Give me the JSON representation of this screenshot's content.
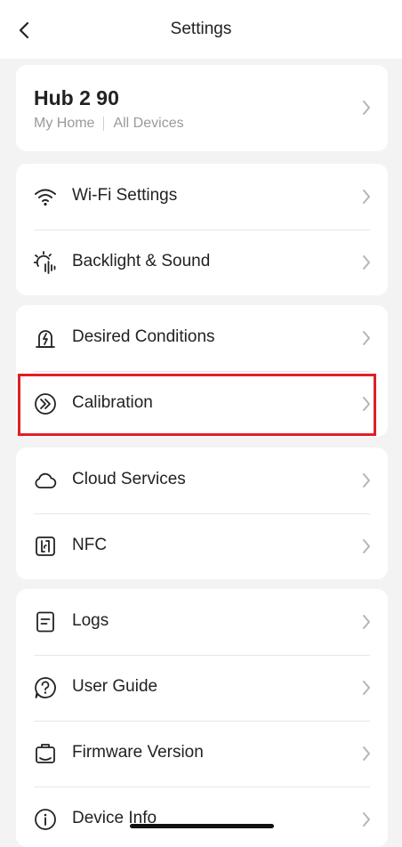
{
  "header": {
    "title": "Settings",
    "back_icon": "chevron-left-icon"
  },
  "hub": {
    "name": "Hub 2 90",
    "location": "My Home",
    "scope": "All Devices"
  },
  "groups": [
    {
      "items": [
        {
          "label": "Wi-Fi Settings",
          "icon": "wifi-icon"
        },
        {
          "label": "Backlight & Sound",
          "icon": "sun-sound-icon"
        }
      ]
    },
    {
      "items": [
        {
          "label": "Desired Conditions",
          "icon": "conditions-icon"
        },
        {
          "label": "Calibration",
          "icon": "calibration-icon",
          "highlighted": true
        }
      ]
    },
    {
      "items": [
        {
          "label": "Cloud Services",
          "icon": "cloud-icon"
        },
        {
          "label": "NFC",
          "icon": "nfc-icon"
        }
      ]
    },
    {
      "items": [
        {
          "label": "Logs",
          "icon": "logs-icon"
        },
        {
          "label": "User Guide",
          "icon": "question-icon"
        },
        {
          "label": "Firmware Version",
          "icon": "firmware-icon"
        },
        {
          "label": "Device Info",
          "icon": "info-icon"
        }
      ]
    }
  ],
  "colors": {
    "highlight": "#e01f26",
    "background": "#f3f3f3",
    "card": "#ffffff",
    "muted_text": "#9a9a9a"
  }
}
